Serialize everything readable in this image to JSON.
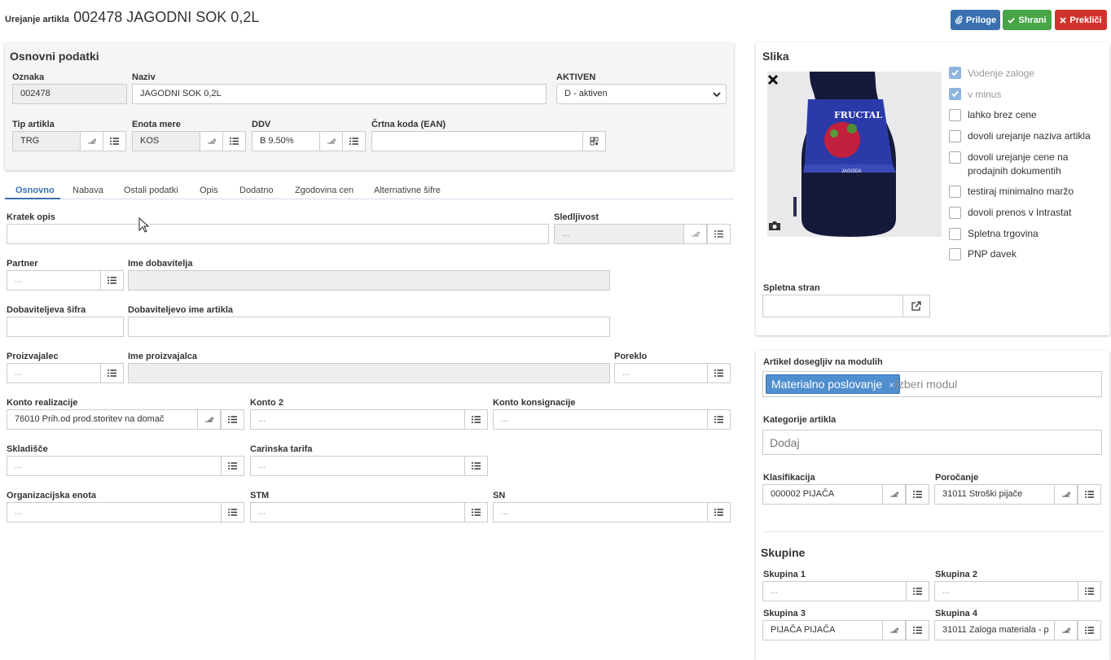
{
  "header": {
    "prefix": "Urejanje artikla",
    "title": "002478 JAGODNI SOK 0,2L"
  },
  "toolbar": {
    "attach": "Priloge",
    "save": "Shrani",
    "cancel": "Prekliči",
    "colors": {
      "attach": "#3a70b0",
      "save": "#47a447",
      "cancel": "#d2322d"
    }
  },
  "basic": {
    "title": "Osnovni podatki",
    "oznaka": {
      "label": "Oznaka",
      "value": "002478"
    },
    "naziv": {
      "label": "Naziv",
      "value": "JAGODNI SOK 0,2L"
    },
    "aktiven": {
      "label": "AKTIVEN",
      "value": "D - aktiven"
    },
    "tip": {
      "label": "Tip artikla",
      "value": "TRG"
    },
    "enota": {
      "label": "Enota mere",
      "value": "KOS"
    },
    "ddv": {
      "label": "DDV",
      "value": "B 9.50%"
    },
    "ean": {
      "label": "Črtna koda (EAN)",
      "value": ""
    }
  },
  "tabs": [
    "Osnovno",
    "Nabava",
    "Ostali podatki",
    "Opis",
    "Dodatno",
    "Zgodovina cen",
    "Alternativne šifre"
  ],
  "form": {
    "kratek_opis": {
      "label": "Kratek opis",
      "value": ""
    },
    "sledljivost": {
      "label": "Sledljivost",
      "value": "..."
    },
    "partner": {
      "label": "Partner",
      "value": "..."
    },
    "ime_dobavitelja": {
      "label": "Ime dobavitelja",
      "value": ""
    },
    "dob_sifra": {
      "label": "Dobaviteljeva šifra",
      "value": ""
    },
    "dob_ime": {
      "label": "Dobaviteljevo ime artikla",
      "value": ""
    },
    "proizvajalec": {
      "label": "Proizvajalec",
      "value": "..."
    },
    "ime_proizvajalca": {
      "label": "Ime proizvajalca",
      "value": ""
    },
    "poreklo": {
      "label": "Poreklo",
      "value": "..."
    },
    "konto_real": {
      "label": "Konto realizacije",
      "value": "76010 Prih.od prod.storitev na domač"
    },
    "konto2": {
      "label": "Konto 2",
      "value": "..."
    },
    "konto_kons": {
      "label": "Konto konsignacije",
      "value": "..."
    },
    "skladisce": {
      "label": "Skladišče",
      "value": "..."
    },
    "carinska": {
      "label": "Carinska tarifa",
      "value": "..."
    },
    "org": {
      "label": "Organizacijska enota",
      "value": "..."
    },
    "stm": {
      "label": "STM",
      "value": "..."
    },
    "sn": {
      "label": "SN",
      "value": "..."
    }
  },
  "slika": {
    "title": "Slika",
    "bottle_brand": "FRUCTAL",
    "bottle_label": "JAGODA",
    "checks": [
      {
        "label": "Vodenje zaloge",
        "checked": true,
        "disabled": true
      },
      {
        "label": "v minus",
        "checked": true,
        "disabled": true
      },
      {
        "label": "lahko brez cene",
        "checked": false
      },
      {
        "label": "dovoli urejanje naziva artikla",
        "checked": false
      },
      {
        "label": "dovoli urejanje cene na prodajnih dokumentih",
        "checked": false
      },
      {
        "label": "testiraj minimalno maržo",
        "checked": false
      },
      {
        "label": "dovoli prenos v Intrastat",
        "checked": false
      },
      {
        "label": "Spletna trgovina",
        "checked": false
      },
      {
        "label": "PNP davek",
        "checked": false
      }
    ],
    "web_label": "Spletna stran",
    "web_value": ""
  },
  "modules": {
    "label": "Artikel dosegljiv na modulih",
    "tag": "Materialno poslovanje",
    "placeholder": "Izberi modul",
    "cat_label": "Kategorije artikla",
    "cat_placeholder": "Dodaj",
    "klas_label": "Klasifikacija",
    "klas_value": "000002 PIJAČA",
    "poroc_label": "Poročanje",
    "poroc_value": "31011 Stroški pijače"
  },
  "groups": {
    "title": "Skupine",
    "s1": {
      "label": "Skupina 1",
      "value": "..."
    },
    "s2": {
      "label": "Skupina 2",
      "value": "..."
    },
    "s3": {
      "label": "Skupina 3",
      "value": "PIJAČA PIJAČA"
    },
    "s4": {
      "label": "Skupina 4",
      "value": "31011 Zaloga materiala - p"
    }
  }
}
